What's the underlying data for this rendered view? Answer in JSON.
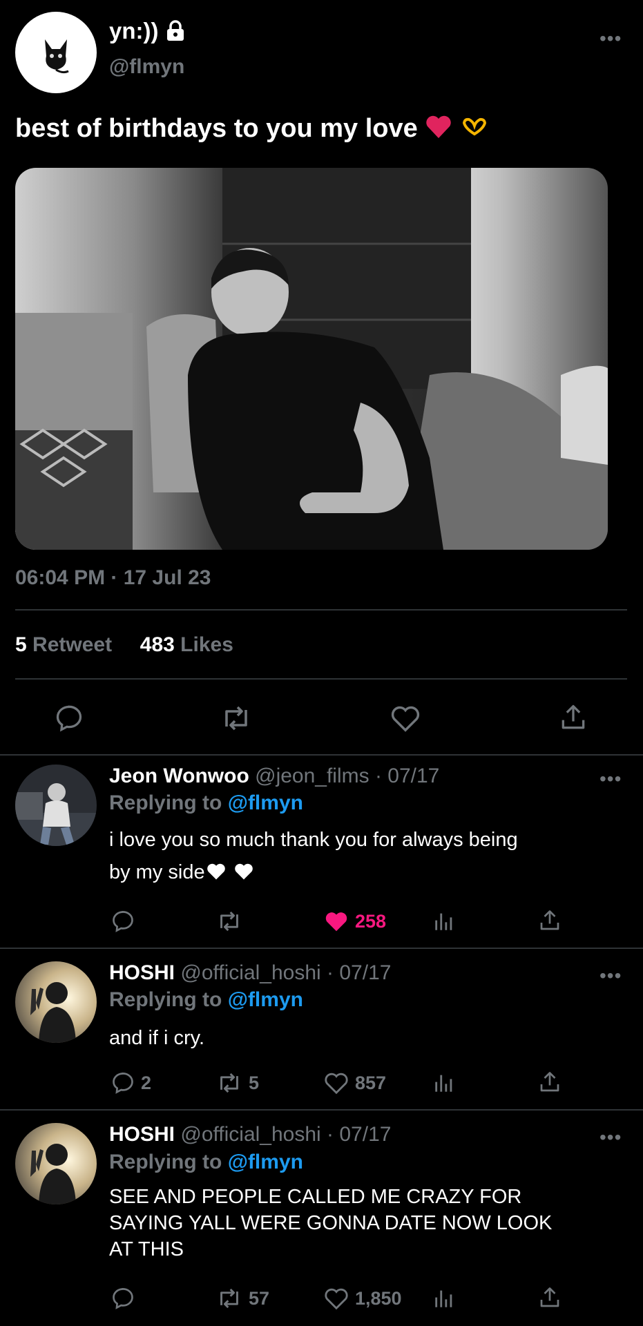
{
  "main": {
    "display_name": "yn:))",
    "handle": "@flmyn",
    "text": "best of birthdays to you my love",
    "timestamp": "06:04 PM · 17 Jul 23",
    "retweets": {
      "count": "5",
      "label": "Retweet"
    },
    "likes": {
      "count": "483",
      "label": "Likes"
    }
  },
  "replies": [
    {
      "name": "Jeon Wonwoo",
      "meta": "@jeon_films · 07/17",
      "replying_label": "Replying to",
      "replying_handle": "@flmyn",
      "line1": "i love you so much thank you for always being",
      "line2": "by my side",
      "like_count": "258"
    },
    {
      "name": "HOSHI",
      "meta": "@official_hoshi · 07/17",
      "replying_label": "Replying to",
      "replying_handle": "@flmyn",
      "line1": "and if i cry.",
      "reply_count": "2",
      "retweet_count": "5",
      "like_count": "857"
    },
    {
      "name": "HOSHI",
      "meta": "@official_hoshi · 07/17",
      "replying_label": "Replying to",
      "replying_handle": "@flmyn",
      "line1": "SEE AND PEOPLE CALLED ME CRAZY FOR",
      "line2": "SAYING YALL WERE GONNA DATE NOW LOOK",
      "line3": "AT THIS",
      "retweet_count": "57",
      "like_count": "1,850"
    }
  ],
  "colors": {
    "background": "#000000",
    "muted": "#71767b",
    "link": "#1d9bf0",
    "like": "#f91880"
  }
}
